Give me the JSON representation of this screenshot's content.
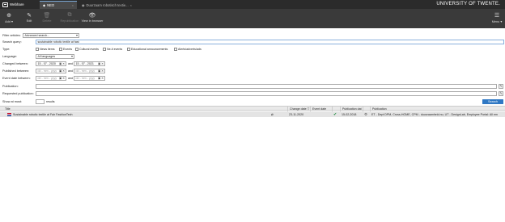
{
  "topbar": {
    "app_name": "Webhare",
    "tabs": [
      {
        "label": "NEO",
        "active": true
      },
      {
        "label": "Duurzaam robotisch textie...",
        "active": false
      }
    ],
    "tab_close": "×",
    "university": "UNIVERSITY OF TWENTE."
  },
  "toolbar": {
    "add": "Add ▾",
    "edit": "Edit",
    "delete": "Delete",
    "republication": "Republication",
    "view_in_browser": "View in browser",
    "menu": "Menu ▾"
  },
  "form": {
    "filter_articles_label": "Filter articles:",
    "filter_articles_value": "Advanced search...",
    "search_query_label": "Search query:",
    "search_query_value": "sustainable robotic textile at fast",
    "type_label": "Type:",
    "types": [
      "News items",
      "Events",
      "Cultural events",
      "Ne-it events",
      "Educational announcements",
      "Alerts/adverts/ads"
    ],
    "language_label": "Language:",
    "language_value": "All languages",
    "changed_between_label": "Changed between:",
    "changed_from": "15 - 07 - 2020",
    "changed_to": "15 - 07 - 2021",
    "published_between_label": "Published between:",
    "published_from": "dd - mm - yyyy",
    "published_to": "dd - mm - yyyy",
    "event_date_label": "Event date between:",
    "event_from": "dd - mm - yyyy",
    "event_to": "dd - mm - yyyy",
    "and": "and",
    "publication_label": "Publication:",
    "requested_publication_label": "Requested publication:",
    "show_at_most_label": "Show at most:",
    "results_label": "results",
    "search_button": "Search",
    "date_icons": "▣ ✕",
    "date_icons_end": "▣ ✕"
  },
  "table": {
    "headers": {
      "title": "Title",
      "change_date": "Change date ▽",
      "event_date": "Event date",
      "publication_date": "Publication dat",
      "publication": "Publication"
    },
    "rows": [
      {
        "title": "Sustainable robotic textile at Fair FashionTech",
        "change_date": "23-11-2020",
        "publication_date": "15-02-2018",
        "publication": "ET - Dept DPM, Cross-HOME, CPM - duurzaamheid.nu, UT - DesignLab, Employee Portal: All em"
      }
    ]
  }
}
